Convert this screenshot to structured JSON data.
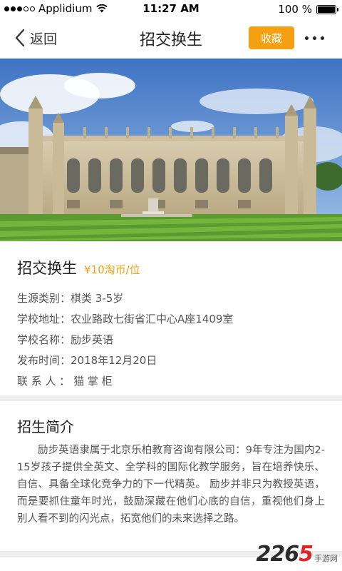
{
  "status_bar": {
    "carrier": "Applidium",
    "time": "11:27 AM",
    "battery_pct": "100 %",
    "battery_level": 1.0
  },
  "nav": {
    "back_label": "返回",
    "title": "招交换生",
    "favorite_label": "收藏"
  },
  "info": {
    "title": "招交换生",
    "price": "¥10淘币/位",
    "rows": [
      "生源类别：棋类 3-5岁",
      "学校地址：农业路政七街省汇中心A座1409室",
      "学校名称：励步英语",
      "发布时间：2018年12月20日",
      "联 系 人 ： 猫 掌 柜"
    ]
  },
  "intro": {
    "title": "招生简介",
    "text": "励步英语隶属于北京乐柏教育咨询有限公司：9年专注为国内2-15岁孩子提供全英文、全学科的国际化教学服务，旨在培养快乐、自信、具备全球化竞争力的下一代精英。 励步并非只为教授英语，而是要抓住童年时光，鼓励深藏在他们心底的自信，重视他们身上别人看不到的闪光点，拓宽他们的未来选择之路。"
  },
  "watermark": {
    "num_a": "22",
    "num_b": "6",
    "num_c": "5",
    "text": "手游网"
  },
  "colors": {
    "accent": "#f5a011",
    "divider": "#eeeeee"
  }
}
